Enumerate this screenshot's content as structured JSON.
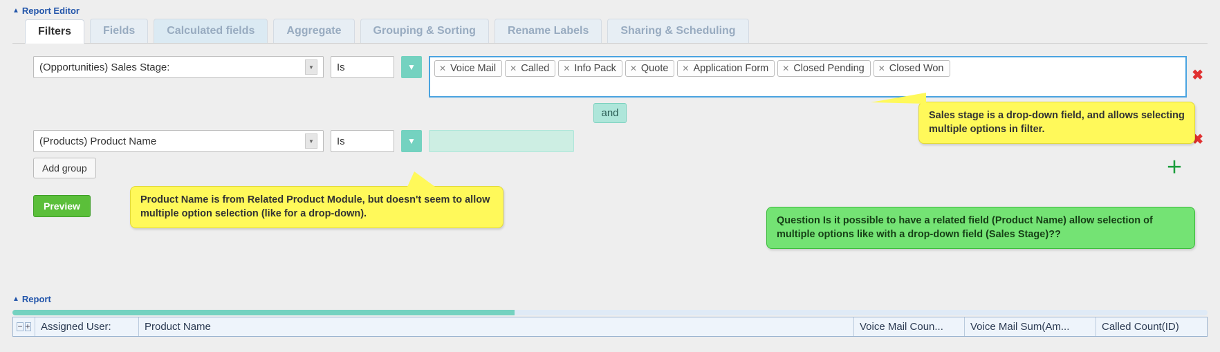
{
  "editor_header": "Report Editor",
  "tabs": {
    "filters": "Filters",
    "fields": "Fields",
    "calculated": "Calculated fields",
    "aggregate": "Aggregate",
    "grouping": "Grouping & Sorting",
    "rename": "Rename Labels",
    "sharing": "Sharing & Scheduling"
  },
  "filter1": {
    "field": "(Opportunities) Sales Stage:",
    "op": "Is",
    "tags": [
      "Voice Mail",
      "Called",
      "Info Pack",
      "Quote",
      "Application Form",
      "Closed Pending",
      "Closed Won"
    ]
  },
  "and_label": "and",
  "filter2": {
    "field": "(Products) Product Name",
    "op": "Is"
  },
  "add_group_label": "Add group",
  "preview_label": "Preview",
  "callout_sales": "Sales stage is a drop-down field, and allows selecting multiple options in filter.",
  "callout_product": "Product Name is from Related Product Module, but doesn't seem to allow multiple option selection (like for a drop-down).",
  "callout_question": "Question Is it possible to have a related field (Product Name) allow selection of multiple options like with a drop-down field (Sales Stage)??",
  "report_header": "Report",
  "progress_pct": 42,
  "grid": {
    "assigned": "Assigned User:",
    "product": "Product Name",
    "vmcount": "Voice Mail Coun...",
    "vmsum": "Voice Mail Sum(Am...",
    "calledcount": "Called Count(ID)"
  }
}
